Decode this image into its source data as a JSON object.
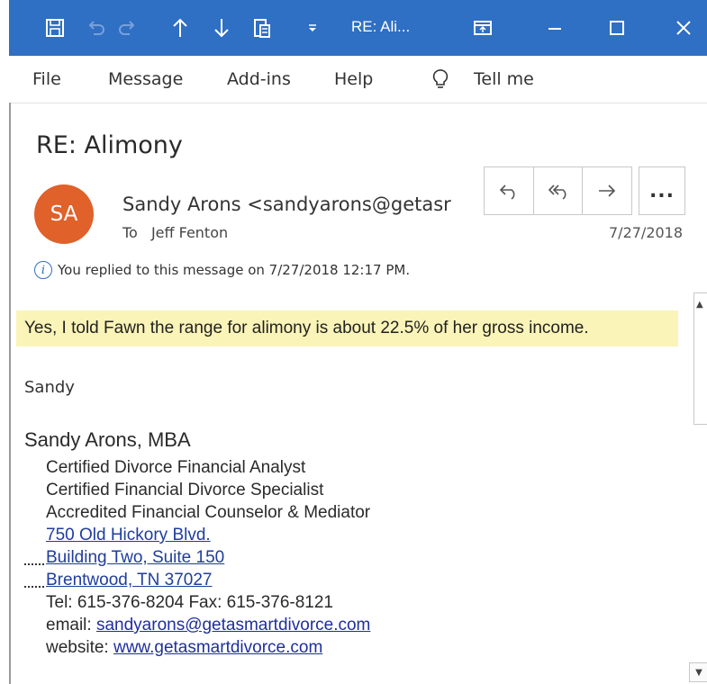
{
  "window": {
    "title": "RE: Ali...",
    "icons": [
      "save-icon",
      "undo-icon",
      "redo-icon",
      "up-arrow-icon",
      "down-arrow-icon",
      "clipboard-icon",
      "customize-dropdown-icon",
      "restore-window-icon",
      "minimize-icon",
      "maximize-icon",
      "close-icon"
    ]
  },
  "menu": {
    "items": [
      "File",
      "Message",
      "Add-ins",
      "Help"
    ],
    "tell_me": "Tell me"
  },
  "message": {
    "subject": "RE: Alimony",
    "avatar_initials": "SA",
    "sender": "Sandy Arons <sandyarons@getasr",
    "to_label": "To",
    "to_name": "Jeff Fenton",
    "date": "7/27/2018",
    "replied_notice": "You replied to this message on 7/27/2018 12:17 PM.",
    "more_label": "...",
    "highlighted_text": "Yes, I told Fawn the range for alimony is about 22.5% of her gross income.",
    "closing_name": "Sandy"
  },
  "signature": {
    "name": "Sandy Arons, MBA",
    "titles": [
      "Certified Divorce Financial Analyst",
      "Certified Financial Divorce Specialist",
      "Accredited Financial Counselor & Mediator"
    ],
    "address": [
      "750 Old Hickory Blvd.",
      "Building Two, Suite 150",
      "Brentwood, TN 37027"
    ],
    "phone_line": "Tel: 615-376-8204 Fax: 615-376-8121",
    "email_label": "email:",
    "email": "sandyarons@getasmartdivorce.com",
    "website_label": "website:",
    "website": "www.getasmartdivorce.com"
  },
  "colors": {
    "titlebar": "#2f6fc4",
    "avatar": "#e0612a",
    "highlight": "#fbf4b8",
    "link": "#1f2f9c"
  }
}
